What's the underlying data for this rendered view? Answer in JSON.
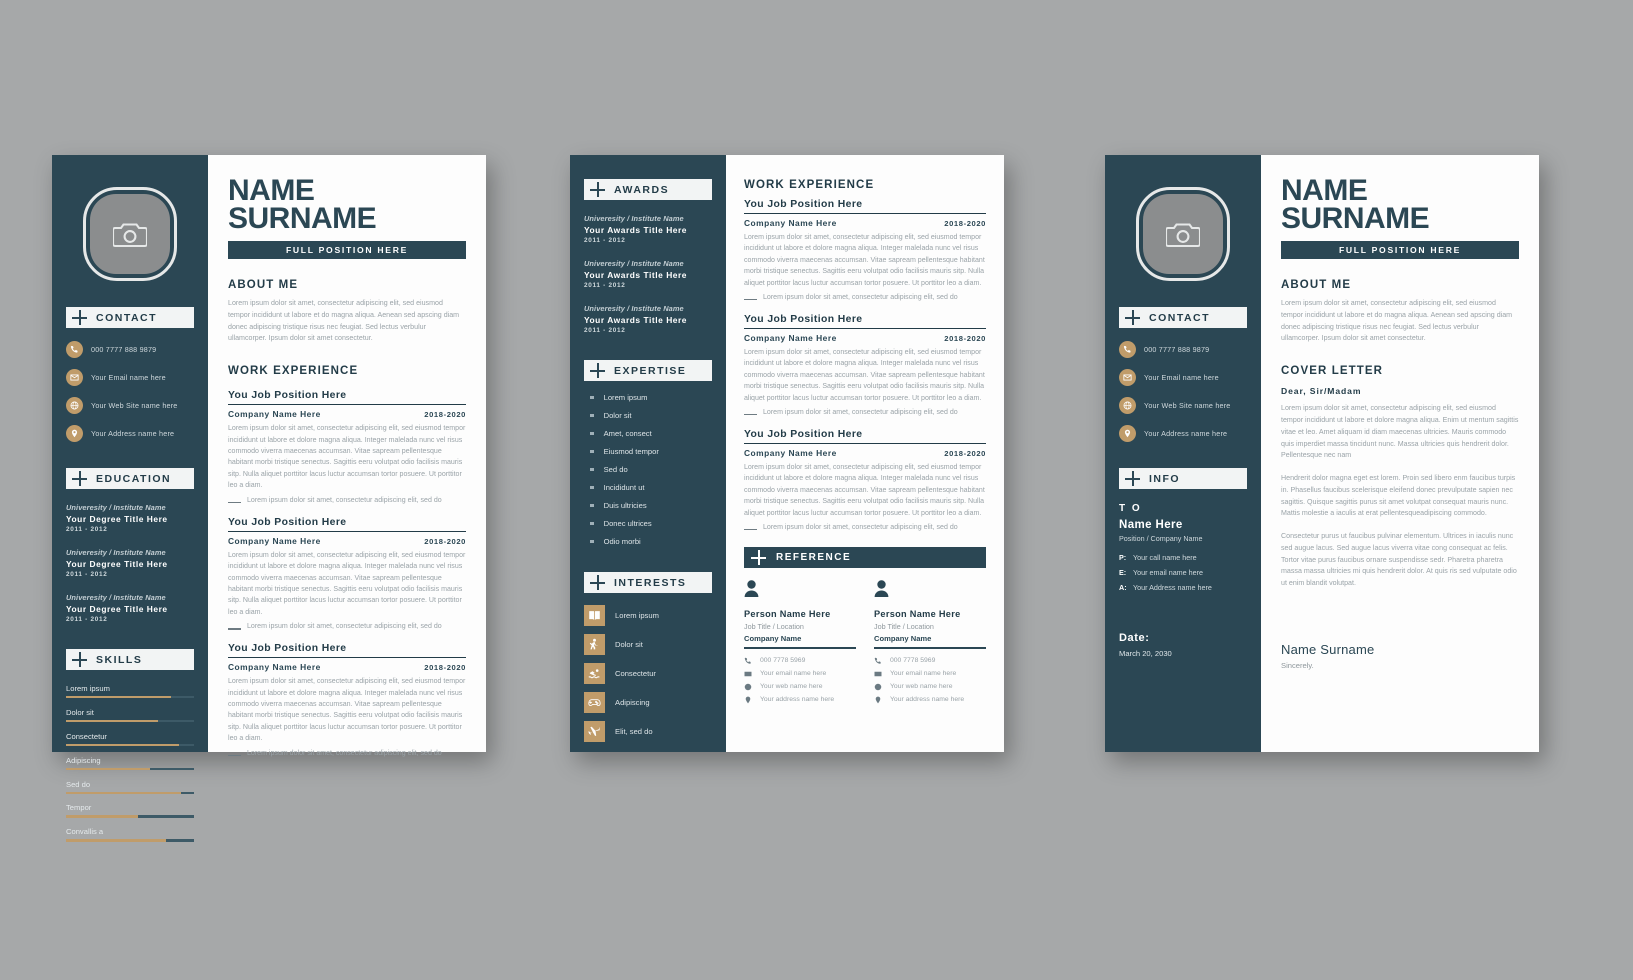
{
  "colors": {
    "navy": "#2b4754",
    "gold": "#c09c6a",
    "background": "#a6a8a9",
    "paper": "#fdfdfd",
    "body_text": "#9aa3a8"
  },
  "identity": {
    "name_line1": "NAME",
    "name_line2": "SURNAME",
    "position_bar": "FULL POSITION HERE"
  },
  "sections": {
    "contact": "CONTACT",
    "education": "EDUCATION",
    "skills": "SKILLS",
    "about_me": "ABOUT ME",
    "work_experience": "WORK EXPERIENCE",
    "awards": "AWARDS",
    "expertise": "EXPERTISE",
    "interests": "INTERESTS",
    "reference": "REFERENCE",
    "info": "INFO",
    "cover_letter": "COVER LETTER"
  },
  "contact": [
    {
      "icon": "phone-icon",
      "text": "000 7777 888 9879"
    },
    {
      "icon": "envelope-icon",
      "text": "Your Email name here"
    },
    {
      "icon": "globe-icon",
      "text": "Your Web Site name here"
    },
    {
      "icon": "location-pin-icon",
      "text": "Your Address name here"
    }
  ],
  "education": [
    {
      "institute": "Univeresity / Institute Name",
      "degree": "Your Degree Title Here",
      "years": "2011 - 2012"
    },
    {
      "institute": "Univeresity / Institute Name",
      "degree": "Your Degree Title Here",
      "years": "2011 - 2012"
    },
    {
      "institute": "Univeresity / Institute Name",
      "degree": "Your Degree Title Here",
      "years": "2011 - 2012"
    }
  ],
  "awards": [
    {
      "institute": "Univeresity / Institute Name",
      "degree": "Your Awards Title Here",
      "years": "2011 - 2012"
    },
    {
      "institute": "Univeresity / Institute Name",
      "degree": "Your Awards Title Here",
      "years": "2011 - 2012"
    },
    {
      "institute": "Univeresity / Institute Name",
      "degree": "Your Awards Title Here",
      "years": "2011 - 2012"
    }
  ],
  "skills": [
    {
      "name": "Lorem ipsum",
      "level": 82
    },
    {
      "name": "Dolor sit",
      "level": 72
    },
    {
      "name": "Consectetur",
      "level": 88
    },
    {
      "name": "Adipiscing",
      "level": 66
    },
    {
      "name": "Sed do",
      "level": 90
    },
    {
      "name": "Tempor",
      "level": 56
    },
    {
      "name": "Convallis a",
      "level": 78
    }
  ],
  "about_me": "Lorem ipsum dolor sit amet, consectetur adipiscing elit, sed eiusmod tempor incididunt ut labore et do magna aliqua. Aenean sed apscing diam donec adipiscing tristique risus nec feugiat. Sed lectus verbulur ullamcorper. Ipsum dolor sit amet consectetur.",
  "jobs": [
    {
      "title": "You Job Position Here",
      "company": "Company Name Here",
      "years": "2018-2020",
      "paragraph": "Lorem ipsum dolor sit amet, consectetur adipiscing elit, sed eiusmod tempor incididunt ut labore et dolore magna aliqua. Integer malelada nunc vel risus commodo viverra maecenas accumsan. Vitae sapream pellentesque habitant morbi tristique senectus. Sagittis eeru volutpat odio facilisis mauris sitp. Nulla aliquet porttitor lacus luctur accumsan tortor posuere. Ut porttitor leo a diam.",
      "bullet": "Lorem ipsum dolor sit amet, consectetur adipiscing elit, sed do"
    },
    {
      "title": "You Job Position Here",
      "company": "Company Name Here",
      "years": "2018-2020",
      "paragraph": "Lorem ipsum dolor sit amet, consectetur adipiscing elit, sed eiusmod tempor incididunt ut labore et dolore magna aliqua. Integer malelada nunc vel risus commodo viverra maecenas accumsan. Vitae sapream pellentesque habitant morbi tristique senectus. Sagittis eeru volutpat odio facilisis mauris sitp. Nulla aliquet porttitor lacus luctur accumsan tortor posuere. Ut porttitor leo a diam.",
      "bullet": "Lorem ipsum dolor sit amet, consectetur adipiscing elit, sed do"
    },
    {
      "title": "You Job Position Here",
      "company": "Company Name Here",
      "years": "2018-2020",
      "paragraph": "Lorem ipsum dolor sit amet, consectetur adipiscing elit, sed eiusmod tempor incididunt ut labore et dolore magna aliqua. Integer malelada nunc vel risus commodo viverra maecenas accumsan. Vitae sapream pellentesque habitant morbi tristique senectus. Sagittis eeru volutpat odio facilisis mauris sitp. Nulla aliquet porttitor lacus luctur accumsan tortor posuere. Ut porttitor leo a diam.",
      "bullet": "Lorem ipsum dolor sit amet, consectetur adipiscing elit, sed do"
    }
  ],
  "expertise": [
    "Lorem ipsum",
    "Dolor sit",
    "Amet, consect",
    "Eiusmod tempor",
    "Sed do",
    "Incididunt ut",
    "Duis ultricies",
    "Donec ultrices",
    "Odio morbi"
  ],
  "interests": [
    {
      "icon": "book-icon",
      "label": "Lorem ipsum"
    },
    {
      "icon": "dancer-icon",
      "label": "Dolor sit"
    },
    {
      "icon": "swimmer-icon",
      "label": "Consectetur"
    },
    {
      "icon": "gamepad-icon",
      "label": "Adipiscing"
    },
    {
      "icon": "airplane-icon",
      "label": "Elit, sed do"
    }
  ],
  "reference": [
    {
      "name": "Person Name Here",
      "job": "Job Title / Location",
      "company": "Company Name",
      "phone": "000 7778 5969",
      "email": "Your email name here",
      "web": "Your web name here",
      "address": "Your address name here"
    },
    {
      "name": "Person Name Here",
      "job": "Job Title / Location",
      "company": "Company Name",
      "phone": "000 7778 5969",
      "email": "Your email name here",
      "web": "Your web name here",
      "address": "Your address name here"
    }
  ],
  "info": {
    "to_label": "T O",
    "to_name": "Name Here",
    "to_position": "Position / Company Name",
    "rows": [
      {
        "key": "P:",
        "value": "Your  call name here"
      },
      {
        "key": "E:",
        "value": "Your  email name here"
      },
      {
        "key": "A:",
        "value": "Your  Address name here"
      }
    ],
    "date_label": "Date:",
    "date_value": "March 20, 2030"
  },
  "cover_letter": {
    "salutation": "Dear, Sir/Madam",
    "para1": "Lorem ipsum dolor sit amet, consectetur adipiscing elit, sed eiusmod tempor incididunt ut labore et dolore magna aliqua. Enim ut mentum sagittis vitae et leo. Amet aliquam id diam maecenas ultricies. Mauris commodo quis imperdiet massa tincidunt nunc. Massa ultricies quis hendrerit dolor. Pellentesque nec nam",
    "para2": "Hendrerit dolor magna eget est lorem. Proin sed libero enm faucibus turpis in. Phasellus faucibus scelerisque eleifend donec prevulputate sapien nec sagittis. Quisque sagittis purus sit amet volutpat consequat mauris nunc. Mattis molestie a iaculis at erat pellentesqueadipiscing commodo.",
    "para3": "Consectetur purus ut faucibus pulvinar elementum. Ultrices in iaculis nunc sed augue lacus. Sed augue lacus viverra vitae cong consequat ac felis. Tortor vitae purus faucibus ornare suspendisse sedr. Pharetra pharetra massa massa ultricies mi quis hendrerit dolor. At quis ris sed vulputate odio ut enim blandit volutpat.",
    "sign_name": "Name Surname",
    "sign_sub": "Sincerely."
  }
}
